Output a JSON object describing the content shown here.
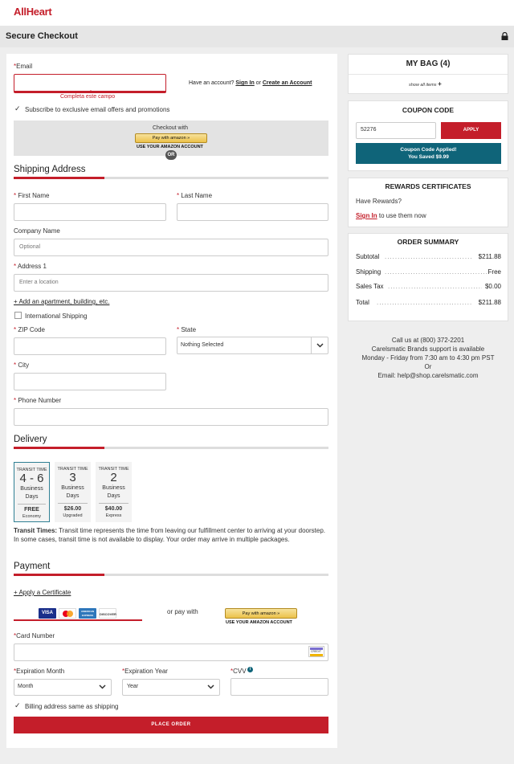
{
  "brand": {
    "logo": "AllHeart"
  },
  "header": {
    "title": "Secure Checkout",
    "lock_icon": "lock-icon"
  },
  "email": {
    "label": "Email",
    "value": "",
    "error": "Completa este campo",
    "account_prompt": "Have an account?",
    "sign_in": "Sign In",
    "or": "or",
    "create_account": "Create an Account",
    "subscribe_label": "Subscribe to exclusive email offers and promotions",
    "subscribe_checked": true
  },
  "amazon_checkout": {
    "title": "Checkout with",
    "button": "Pay with amazon",
    "caption": "USE YOUR AMAZON ACCOUNT",
    "or_badge": "OR"
  },
  "shipping": {
    "title": "Shipping Address",
    "first_name_label": "First Name",
    "last_name_label": "Last Name",
    "company_label": "Company Name",
    "company_placeholder": "Optional",
    "address1_label": "Address 1",
    "address1_placeholder": "Enter a location",
    "add_apartment": "+ Add an apartment, building, etc.",
    "international_label": "International Shipping",
    "zip_label": "ZIP Code",
    "state_label": "State",
    "state_value": "Nothing Selected",
    "city_label": "City",
    "phone_label": "Phone Number"
  },
  "delivery": {
    "title": "Delivery",
    "options": [
      {
        "head": "TRANSIT TIME",
        "days": "4 - 6",
        "unit1": "Business",
        "unit2": "Days",
        "price": "FREE",
        "name": "Economy",
        "selected": true
      },
      {
        "head": "TRANSIT TIME",
        "days": "3",
        "unit1": "Business",
        "unit2": "Days",
        "price": "$26.00",
        "name": "Upgraded",
        "selected": false
      },
      {
        "head": "TRANSIT TIME",
        "days": "2",
        "unit1": "Business",
        "unit2": "Days",
        "price": "$40.00",
        "name": "Express",
        "selected": false
      }
    ],
    "note_title": "Transit Times:",
    "note_text": "Transit time represents the time from leaving our fulfillment center to arriving at your doorstep. In some cases, transit time is not available to display. Your order may arrive in multiple packages."
  },
  "payment": {
    "title": "Payment",
    "apply_certificate": "+ Apply a Certificate",
    "cards": [
      "VISA",
      "MC",
      "AMERICAN EXPRESS",
      "DISCOVER"
    ],
    "or_pay_with": "or pay with",
    "amazon_button": "Pay with amazon",
    "amazon_caption": "USE YOUR AMAZON ACCOUNT",
    "card_number_label": "Card Number",
    "card_badge": "CREDIT",
    "exp_month_label": "Expiration Month",
    "exp_month_value": "Month",
    "exp_year_label": "Expiration Year",
    "exp_year_value": "Year",
    "cvv_label": "CVV",
    "billing_same": "Billing address same as shipping",
    "billing_checked": true,
    "place_order": "PLACE ORDER"
  },
  "bag": {
    "title": "MY BAG (4)",
    "show_all": "show all items",
    "plus": "+"
  },
  "coupon": {
    "title": "COUPON CODE",
    "value": "52276",
    "apply": "APPLY",
    "applied": "Coupon Code Applied!",
    "saved": "You Saved $9.99"
  },
  "rewards": {
    "title": "REWARDS CERTIFICATES",
    "question": "Have Rewards?",
    "sign_in": "Sign In",
    "suffix": "to use them now"
  },
  "summary": {
    "title": "ORDER SUMMARY",
    "rows": [
      {
        "label": "Subtotal",
        "value": "$211.88"
      },
      {
        "label": "Shipping",
        "value": "Free"
      },
      {
        "label": "Sales Tax",
        "value": "$0.00"
      },
      {
        "label": "Total",
        "value": "$211.88"
      }
    ]
  },
  "contact": {
    "line1": "Call us at (800) 372-2201",
    "line2": "Carelsmatic Brands support is available",
    "line3": "Monday - Friday from 7:30 am to 4:30 pm PST",
    "line4": "Or",
    "line5": "Email: help@shop.carelsmatic.com"
  },
  "colors": {
    "brand_red": "#c41e2a",
    "teal": "#0f6479",
    "amazon_yellow": "#ecc14a"
  }
}
